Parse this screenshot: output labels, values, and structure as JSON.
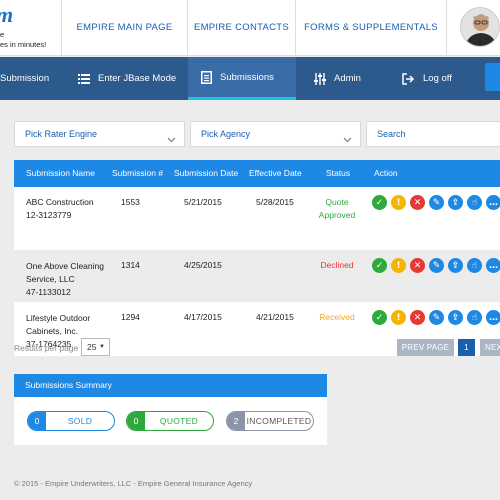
{
  "header": {
    "brand_logo": "m",
    "brand_line1": "e",
    "brand_line2": "es in minutes!",
    "links": [
      "EMPIRE MAIN PAGE",
      "EMPIRE CONTACTS",
      "FORMS & SUPPLEMENTALS"
    ]
  },
  "nav": {
    "items": [
      {
        "label": "Submission",
        "icon": "list-icon"
      },
      {
        "label": "Enter JBase Mode",
        "icon": "list-icon"
      },
      {
        "label": "Submissions",
        "icon": "document-icon"
      },
      {
        "label": "Admin",
        "icon": "sliders-icon"
      },
      {
        "label": "Log off",
        "icon": "logout-icon"
      }
    ],
    "active": "Submissions"
  },
  "filters": {
    "rater_engine": "Pick Rater Engine",
    "agency": "Pick Agency",
    "search_placeholder": "Search"
  },
  "table": {
    "columns": [
      "Submission Name",
      "Submission #",
      "Submission Date",
      "Effective Date",
      "Status",
      "Action"
    ],
    "rows": [
      {
        "name_line1": "ABC Construction",
        "name_line2": "",
        "id_line": "12-3123779",
        "number": "1553",
        "submission_date": "5/21/2015",
        "effective_date": "5/28/2015",
        "status_line1": "Quote",
        "status_line2": "Approved",
        "status_color": "#2eaa3c"
      },
      {
        "name_line1": "One Above Cleaning",
        "name_line2": "Service, LLC",
        "id_line": "47-1133012",
        "number": "1314",
        "submission_date": "4/25/2015",
        "effective_date": "",
        "status_line1": "Declined",
        "status_line2": "",
        "status_color": "#e53935"
      },
      {
        "name_line1": "Lifestyle Outdoor",
        "name_line2": "Cabinets, Inc.",
        "id_line": "37-1764235",
        "number": "1294",
        "submission_date": "4/17/2015",
        "effective_date": "4/21/2015",
        "status_line1": "Received",
        "status_line2": "",
        "status_color": "#f5a623"
      }
    ],
    "action_icons": [
      {
        "name": "approve-icon",
        "glyph": "✓",
        "color": "#2eaa3c"
      },
      {
        "name": "warning-icon",
        "glyph": "!",
        "color": "#f5b400"
      },
      {
        "name": "delete-icon",
        "glyph": "✕",
        "color": "#e53935"
      },
      {
        "name": "edit-icon",
        "glyph": "✎",
        "color": "#1e88e5"
      },
      {
        "name": "upload-icon",
        "glyph": "⇪",
        "color": "#1e88e5"
      },
      {
        "name": "hand-icon",
        "glyph": "☝",
        "color": "#1e88e5"
      },
      {
        "name": "comment-icon",
        "glyph": "…",
        "color": "#1e88e5"
      }
    ]
  },
  "pagination": {
    "rpp_label": "Results per page",
    "rpp_value": "25",
    "prev_label": "PREV PAGE",
    "current_page": "1",
    "next_label": "NEXT"
  },
  "summary": {
    "title": "Submissions Summary",
    "sold": {
      "count": "0",
      "label": "SOLD",
      "color": "#1e88e5"
    },
    "quoted": {
      "count": "0",
      "label": "QUOTED",
      "color": "#2eaa3c"
    },
    "incompleted": {
      "count": "2",
      "label": "INCOMPLETED",
      "color": "#8a96a8"
    }
  },
  "footer": "© 2015 - Empire Underwriters, LLC - Empire General Insurance Agency"
}
